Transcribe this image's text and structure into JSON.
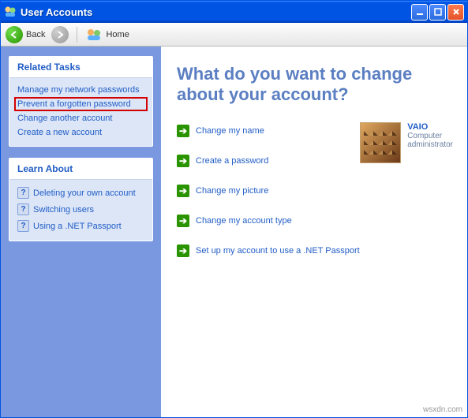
{
  "window": {
    "title": "User Accounts"
  },
  "toolbar": {
    "back": "Back",
    "home": "Home"
  },
  "sidebar": {
    "related": {
      "heading": "Related Tasks",
      "items": [
        "Manage my network passwords",
        "Prevent a forgotten password",
        "Change another account",
        "Create a new account"
      ]
    },
    "learn": {
      "heading": "Learn About",
      "items": [
        "Deleting your own account",
        "Switching users",
        "Using a .NET Passport"
      ]
    }
  },
  "main": {
    "heading": "What do you want to change about your account?",
    "tasks": [
      "Change my name",
      "Create a password",
      "Change my picture",
      "Change my account type",
      "Set up my account to use a .NET Passport"
    ]
  },
  "user": {
    "name": "VAIO",
    "role_line1": "Computer",
    "role_line2": "administrator"
  },
  "watermark": "wsxdn.com"
}
